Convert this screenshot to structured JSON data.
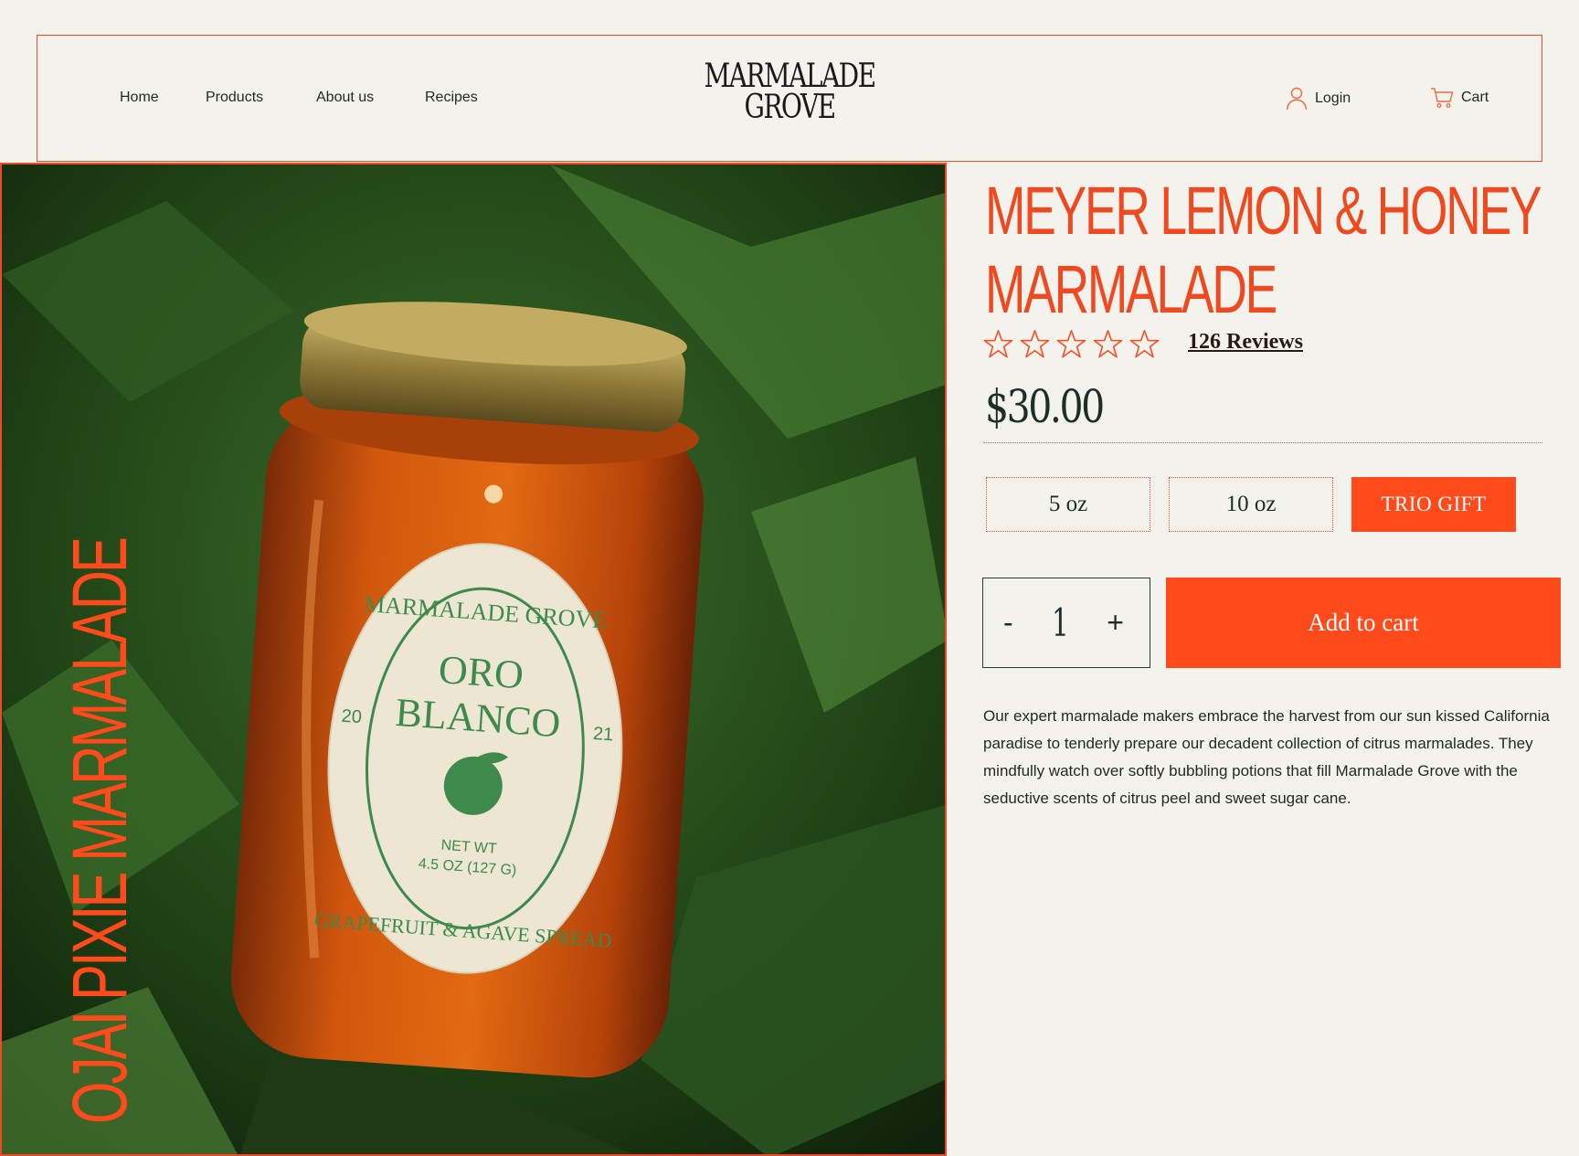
{
  "header": {
    "nav": [
      {
        "label": "Home"
      },
      {
        "label": "Products"
      },
      {
        "label": "About us"
      },
      {
        "label": "Recipes"
      }
    ],
    "logo_line1": "MARMALADE",
    "logo_line2": "GROVE",
    "login_label": "Login",
    "cart_label": "Cart"
  },
  "image": {
    "vertical_text": "OJAI PIXIE MARMALADE",
    "label_top": "MARMALADE GROVE",
    "label_name_line1": "ORO",
    "label_name_line2": "BLANCO",
    "label_year_left": "20",
    "label_year_right": "21",
    "label_netwt": "NET WT",
    "label_weight": "4.5 OZ (127 G)",
    "label_bottom": "GRAPEFRUIT & AGAVE SPREAD"
  },
  "product": {
    "title": "MEYER LEMON & HONEY MARMALADE",
    "rating": 0,
    "max_rating": 5,
    "reviews_label": "126 Reviews",
    "price": "$30.00",
    "sizes": [
      {
        "label": "5 oz",
        "selected": false
      },
      {
        "label": "10 oz",
        "selected": false
      },
      {
        "label": "TRIO GIFT",
        "selected": true
      }
    ],
    "quantity": {
      "minus": "-",
      "value": "1",
      "plus": "+"
    },
    "add_to_cart_label": "Add to cart",
    "description": "Our expert marmalade makers embrace the harvest from our sun kissed California paradise to tenderly prepare our decadent collection of citrus marmalades. They mindfully watch over softly bubbling potions that fill Marmalade Grove with the seductive scents of citrus peel and sweet sugar cane."
  },
  "colors": {
    "accent": "#ff4a1c",
    "border": "#ef4a24",
    "background": "#f4f2ec",
    "text": "#1d2e27"
  }
}
